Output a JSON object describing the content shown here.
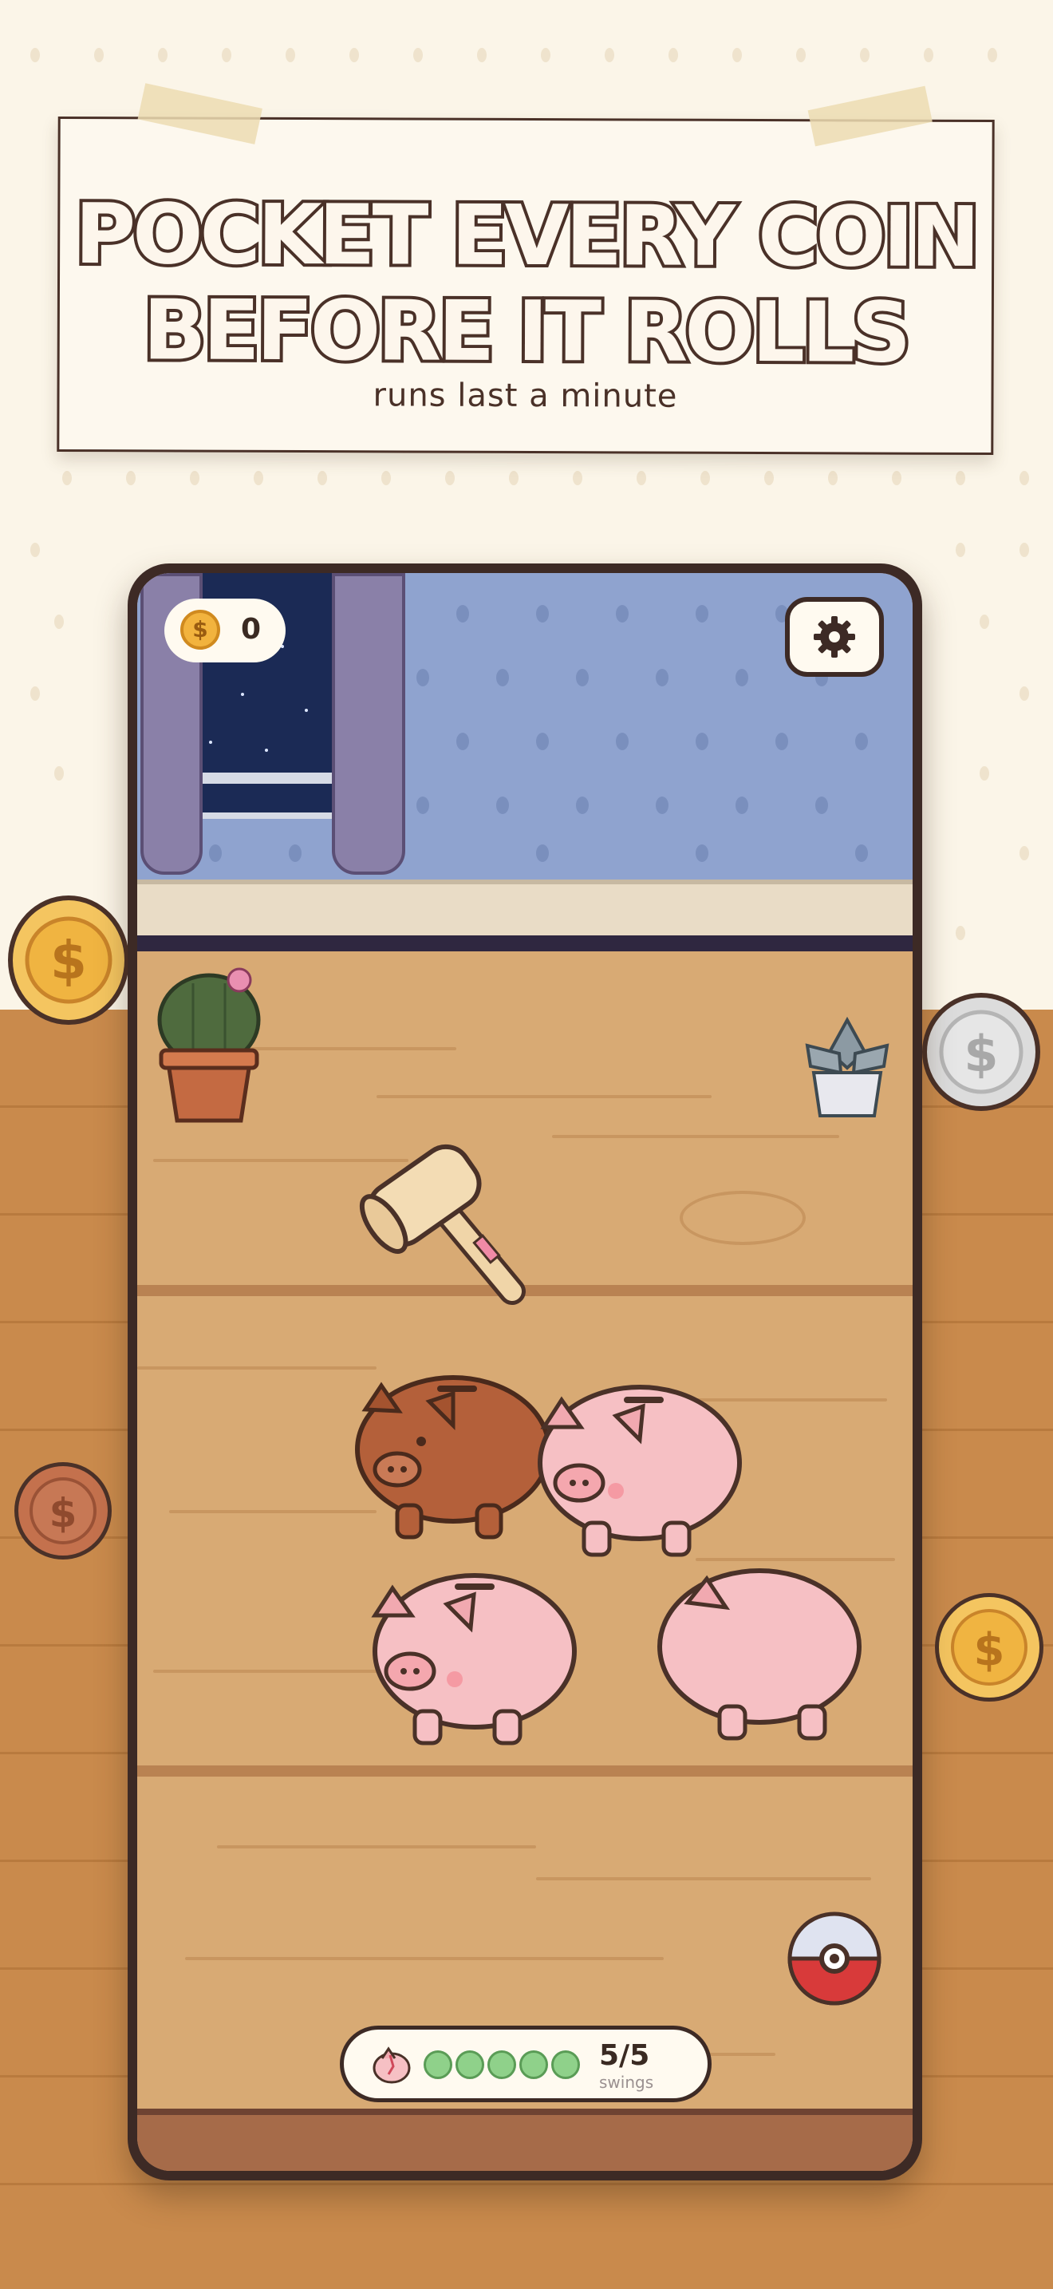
{
  "banner": {
    "headline_line1": "POCKET EVERY COIN",
    "headline_line2": "BEFORE IT ROLLS",
    "subtitle": "runs last a minute"
  },
  "hud": {
    "coin_icon": "gold-dollar-coin",
    "coin_count": "0",
    "settings_icon": "gear-icon"
  },
  "swings": {
    "icon": "broken-piggy-icon",
    "pips_total": 5,
    "pips_remaining": 5,
    "count_text": "5/5",
    "label": "swings"
  },
  "scene": {
    "objects": [
      "cactus-pot",
      "succulent-pot",
      "wooden-mallet",
      "brown-piggy-bank",
      "pink-piggy-bank",
      "pink-piggy-bank",
      "pink-piggy-bank",
      "red-white-ball"
    ]
  },
  "decor_coins": {
    "symbol": "$",
    "colors": [
      "gold",
      "silver",
      "bronze",
      "gold"
    ]
  },
  "colors": {
    "accent_dark": "#4a3128",
    "cream": "#fbf5e8",
    "wood": "#d8aa74",
    "wall": "#8fa3cf",
    "pip_green": "#8fd18a",
    "pig_pink": "#f6c0c4",
    "pig_brown": "#b4603a"
  }
}
